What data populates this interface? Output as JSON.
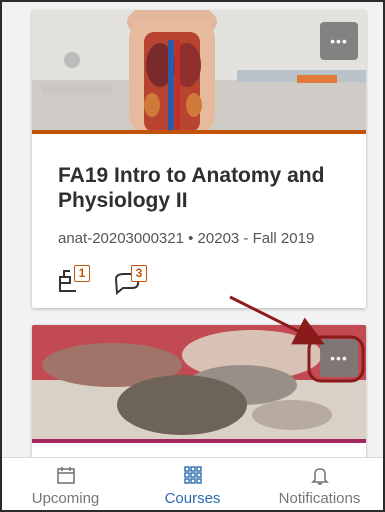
{
  "courses": [
    {
      "title": "FA19 Intro to Anatomy and Physiology II",
      "subtitle": "anat-20203000321 • 20203 - Fall 2019",
      "more_label": "•••",
      "assignments_count": "1",
      "discussions_count": "3",
      "accent_color": "#c2540a",
      "image": "anatomy-model-lab-photo"
    },
    {
      "more_label": "•••",
      "accent_color": "#a3275a",
      "image": "hands-shaping-clay-photo"
    }
  ],
  "bottom_nav": {
    "items": [
      {
        "label": "Upcoming",
        "icon": "calendar-icon"
      },
      {
        "label": "Courses",
        "icon": "grid-icon",
        "active": true
      },
      {
        "label": "Notifications",
        "icon": "bell-icon"
      }
    ],
    "active_color": "#2b6cb0"
  },
  "annotation": {
    "color": "#8b1a1a",
    "type": "arrow-and-circle"
  }
}
